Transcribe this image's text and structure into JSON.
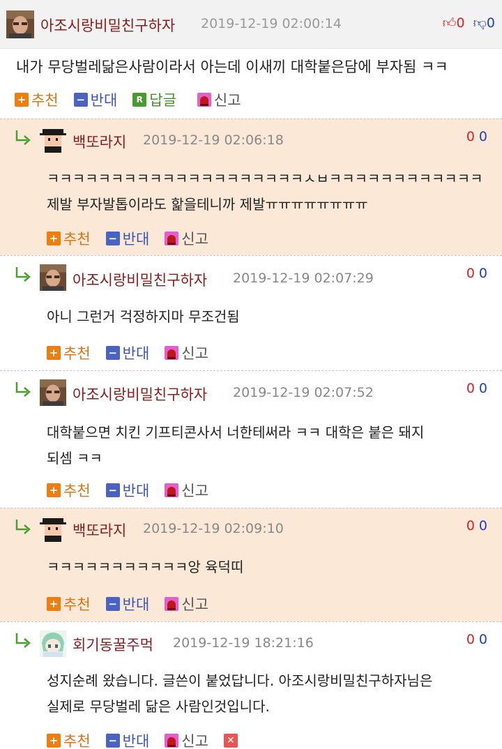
{
  "post": {
    "author": "아조시랑비밀친구하자",
    "datetime": "2019-12-19 02:00:14",
    "likes": "0",
    "dislikes": "0",
    "text": "내가 무당벌레닮은사람이라서 아는데 이새끼 대학붙은담에 부자됨 ㅋㅋ",
    "actions": {
      "recommend": "추천",
      "oppose": "반대",
      "reply": "답글",
      "report": "신고"
    }
  },
  "replies": [
    {
      "author": "백또라지",
      "datetime": "2019-12-19 02:06:18",
      "up": "0",
      "down": "0",
      "lines": [
        "ㅋㅋㅋㅋㅋㅋㅋㅋㅋㅋㅋㅋㅋㅋㅋㅋㅋㅋㅋㅋㅅㅂㅋㅋㅋㅋㅋㅋㅋㅋㅋㅋㅋㅋ",
        "제발 부자발톱이라도 핥을테니까 제발ㅠㅠㅠㅠㅠㅠㅠㅠ"
      ],
      "actions": {
        "recommend": "추천",
        "oppose": "반대",
        "report": "신고"
      }
    },
    {
      "author": "아조시랑비밀친구하자",
      "datetime": "2019-12-19 02:07:29",
      "up": "0",
      "down": "0",
      "lines": [
        "아니 그런거 걱정하지마 무조건됨"
      ],
      "actions": {
        "recommend": "추천",
        "oppose": "반대",
        "report": "신고"
      }
    },
    {
      "author": "아조시랑비밀친구하자",
      "datetime": "2019-12-19 02:07:52",
      "up": "0",
      "down": "0",
      "lines": [
        "대학붙으면 치킨 기프티콘사서 너한테써라 ㅋㅋ 대학은 붙은 돼지",
        "되셈 ㅋㅋ"
      ],
      "actions": {
        "recommend": "추천",
        "oppose": "반대",
        "report": "신고"
      }
    },
    {
      "author": "백또라지",
      "datetime": "2019-12-19 02:09:10",
      "up": "0",
      "down": "0",
      "lines": [
        "ㅋㅋㅋㅋㅋㅋㅋㅋㅋㅋㅋ앙 육덕띠"
      ],
      "actions": {
        "recommend": "추천",
        "oppose": "반대",
        "report": "신고"
      }
    },
    {
      "author": "회기동꿀주먹",
      "datetime": "2019-12-19 18:21:16",
      "up": "0",
      "down": "0",
      "lines": [
        "성지순례 왔습니다. 글쓴이 붙었답니다. 아조시랑비밀친구하자님은",
        "실제로 무당벌레 닮은 사람인것입니다."
      ],
      "actions": {
        "recommend": "추천",
        "oppose": "반대",
        "report": "신고"
      }
    }
  ],
  "colors": {
    "author": "#8b1c1c",
    "highlight_bg": "#fbe8d6",
    "header_bg": "#f2f2f2",
    "up": "#e02020",
    "down": "#1f3fbf"
  }
}
